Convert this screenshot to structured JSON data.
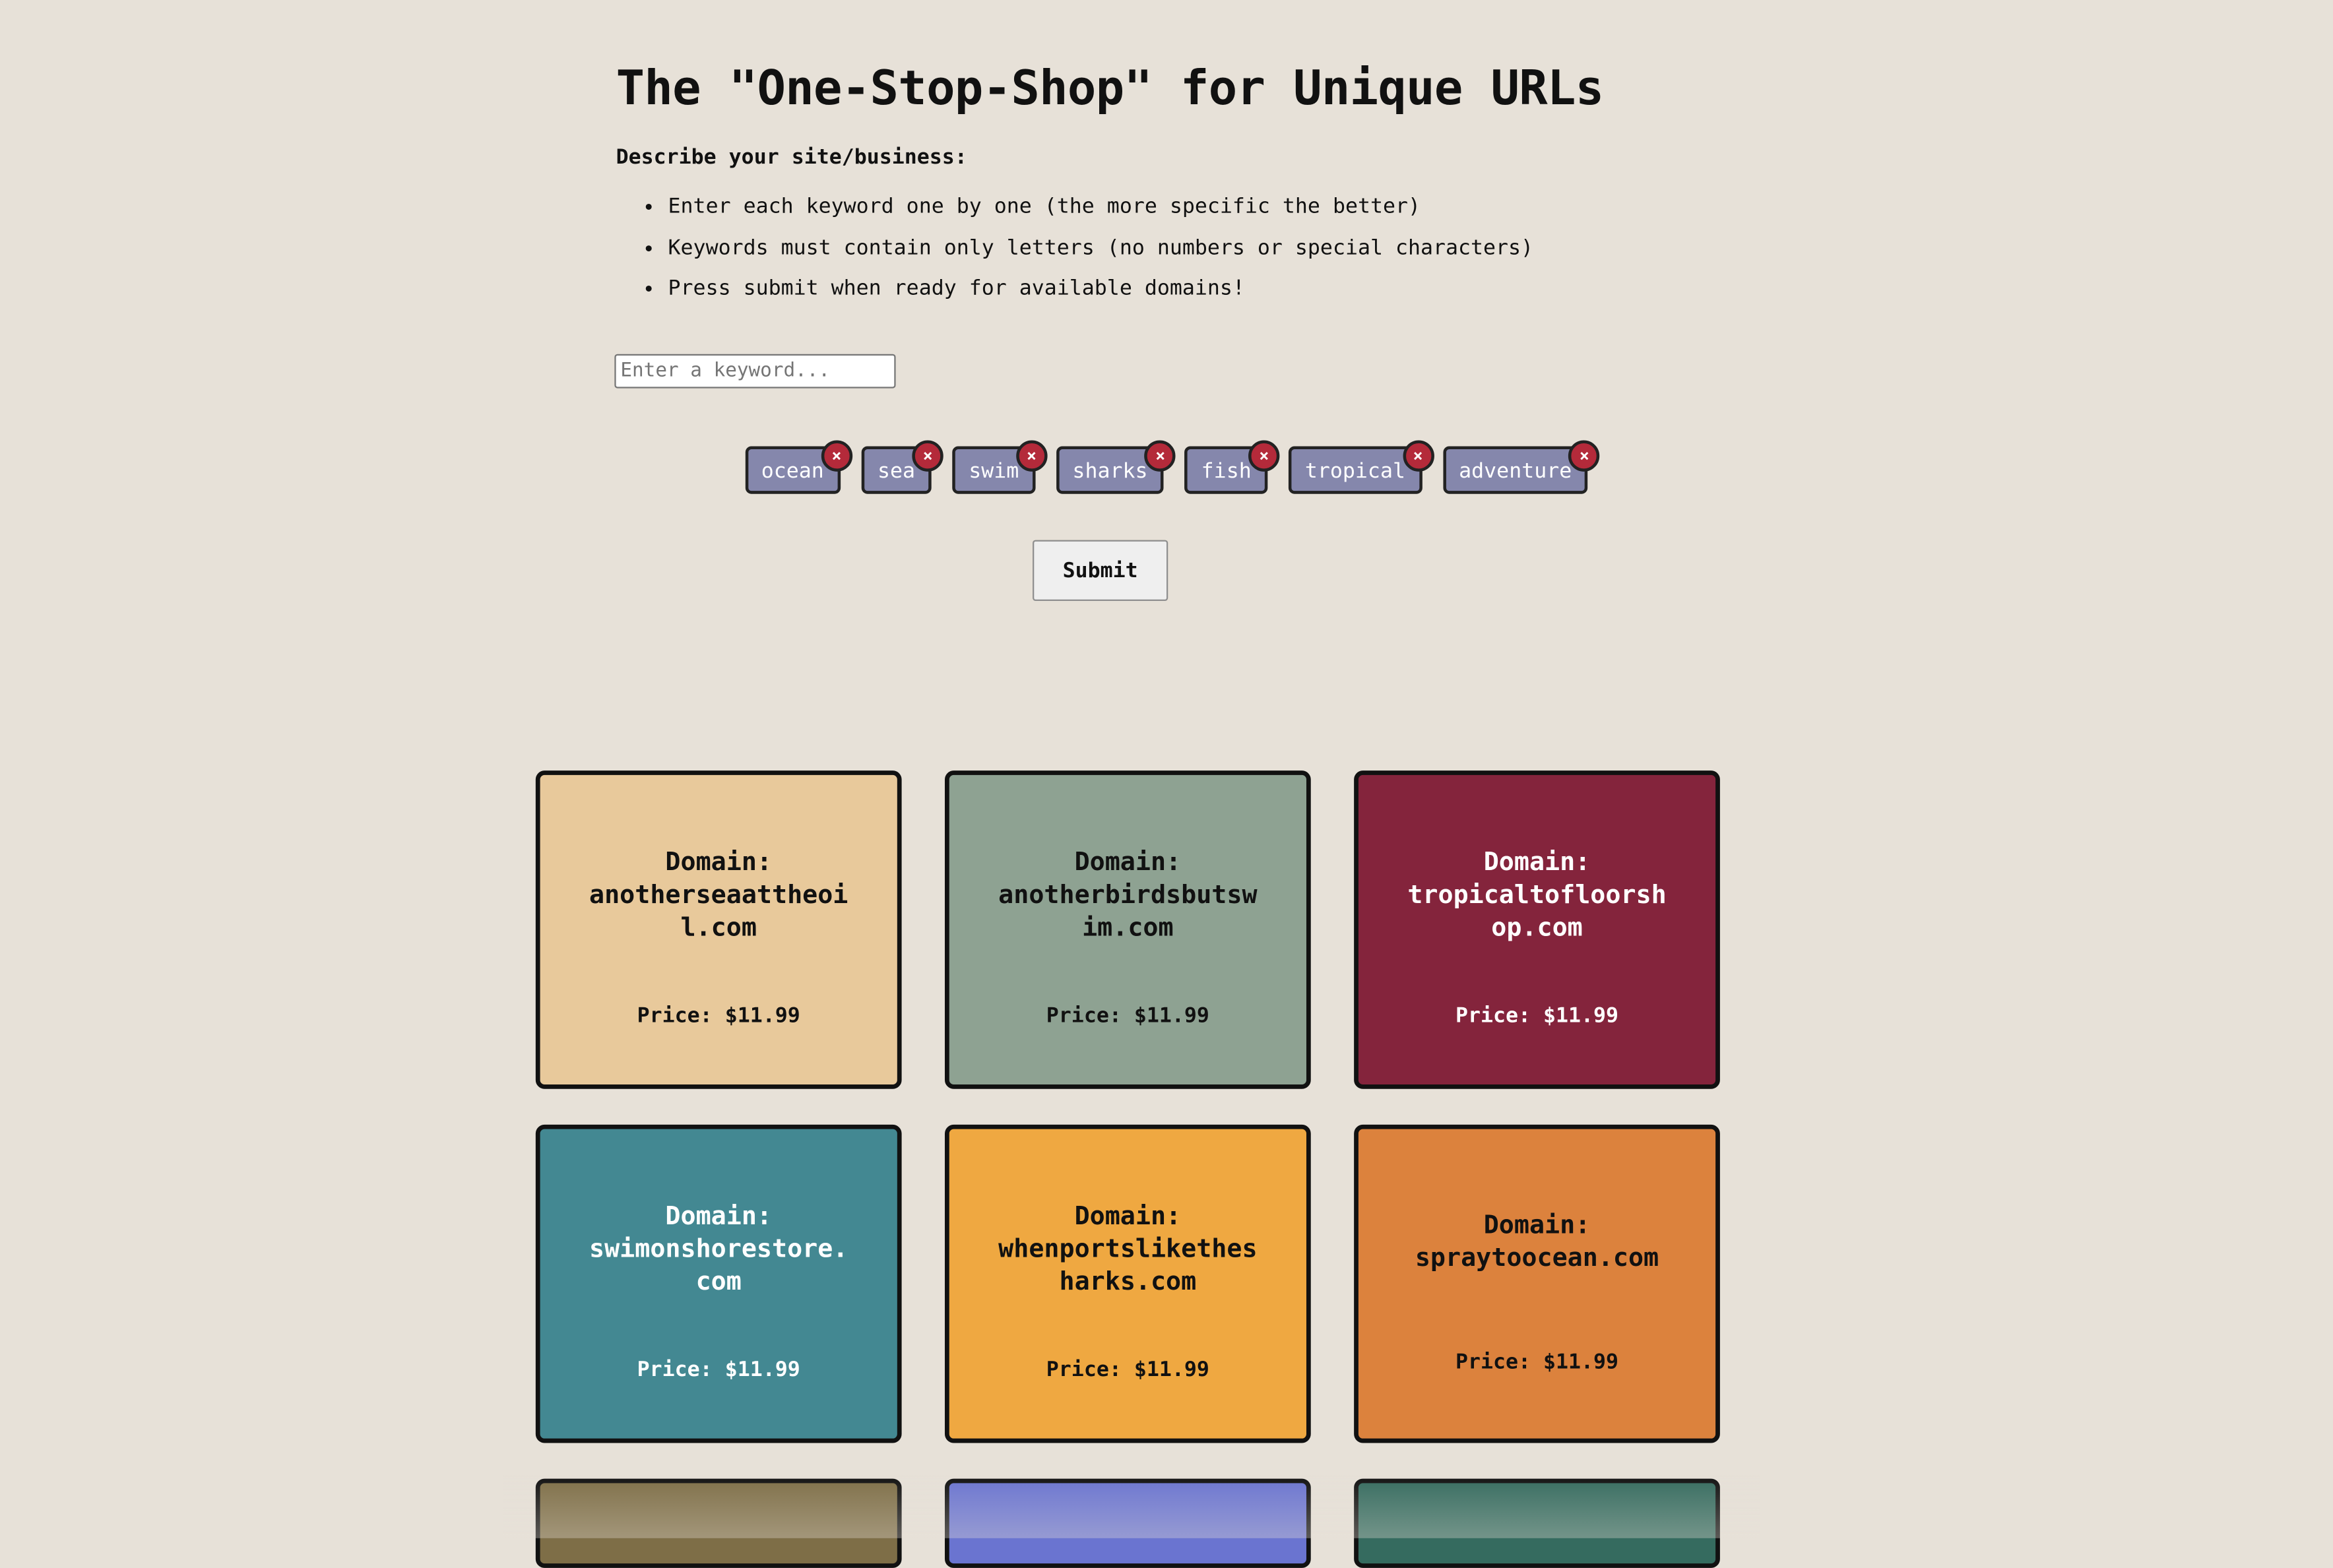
{
  "header": {
    "title": "The \"One-Stop-Shop\" for Unique URLs",
    "intro": "Describe your site/business:",
    "rules": [
      "Enter each keyword one by one (the more specific the better)",
      "Keywords must contain only letters (no numbers or special characters)",
      "Press submit when ready for available domains!"
    ]
  },
  "keyword_input": {
    "value": "",
    "placeholder": "Enter a keyword..."
  },
  "tags": [
    {
      "label": "ocean",
      "remove_icon": "×"
    },
    {
      "label": "sea",
      "remove_icon": "×"
    },
    {
      "label": "swim",
      "remove_icon": "×"
    },
    {
      "label": "sharks",
      "remove_icon": "×"
    },
    {
      "label": "fish",
      "remove_icon": "×"
    },
    {
      "label": "tropical",
      "remove_icon": "×"
    },
    {
      "label": "adventure",
      "remove_icon": "×"
    }
  ],
  "submit_label": "Submit",
  "results": [
    {
      "domain_heading": "Domain:",
      "domain": "anotherseaattheoil.com",
      "price": "Price: $11.99",
      "bg": "#e8c99b",
      "fg": "#111111"
    },
    {
      "domain_heading": "Domain:",
      "domain": "anotherbirdsbutswim.com",
      "price": "Price: $11.99",
      "bg": "#8ea292",
      "fg": "#111111"
    },
    {
      "domain_heading": "Domain:",
      "domain": "tropicaltofloorshop.com",
      "price": "Price: $11.99",
      "bg": "#84243c",
      "fg": "#ffffff"
    },
    {
      "domain_heading": "Domain:",
      "domain": "swimonshorestore.com",
      "price": "Price: $11.99",
      "bg": "#438892",
      "fg": "#ffffff"
    },
    {
      "domain_heading": "Domain:",
      "domain": "whenportslikethesharks.com",
      "price": "Price: $11.99",
      "bg": "#efa841",
      "fg": "#111111"
    },
    {
      "domain_heading": "Domain:",
      "domain": "spraytoocean.com",
      "price": "Price: $11.99",
      "bg": "#dc823d",
      "fg": "#111111"
    }
  ],
  "partial_results": [
    {
      "bg": "#7e6e47"
    },
    {
      "bg": "#6a74d0"
    },
    {
      "bg": "#356b5f"
    }
  ],
  "colors": {
    "page_bg": "#e7e1d8",
    "tag_bg": "#8587ac",
    "tag_remove_bg": "#b42a3a"
  }
}
